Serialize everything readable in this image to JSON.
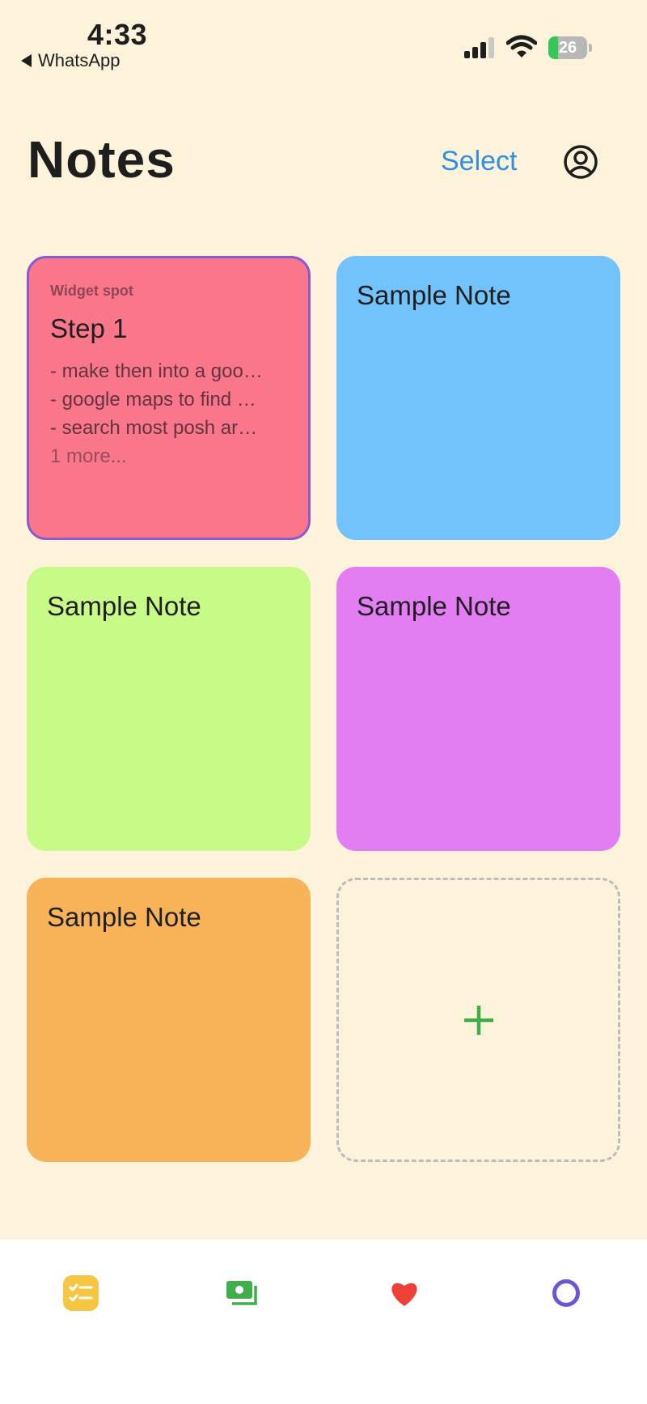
{
  "status_bar": {
    "time": "4:33",
    "back_app": "WhatsApp",
    "battery_level": "26",
    "battery_fraction": 0.26
  },
  "header": {
    "title": "Notes",
    "select_label": "Select",
    "profile_icon": "person-circle-icon"
  },
  "notes": [
    {
      "widget_label": "Widget spot",
      "title": "Step 1",
      "lines": [
        "- make then into a goo…",
        "- google maps to find …",
        "- search most posh ar…"
      ],
      "more": "1 more...",
      "color": "#f9768b",
      "border_color": "#8a5bd0"
    },
    {
      "title": "Sample Note",
      "color": "#72c3fb"
    },
    {
      "title": "Sample Note",
      "color": "#c7fa86"
    },
    {
      "title": "Sample Note",
      "color": "#e27ef2"
    },
    {
      "title": "Sample Note",
      "color": "#f8b358"
    }
  ],
  "add_card": {
    "icon": "plus-icon",
    "color": "#3fae4b"
  },
  "tabbar": {
    "tabs": [
      {
        "name": "checklist-icon",
        "color": "#f6c542"
      },
      {
        "name": "money-icon",
        "color": "#3fae4b"
      },
      {
        "name": "heart-icon",
        "color": "#ee4035"
      },
      {
        "name": "circle-icon",
        "color": "#6c55d6"
      }
    ]
  }
}
